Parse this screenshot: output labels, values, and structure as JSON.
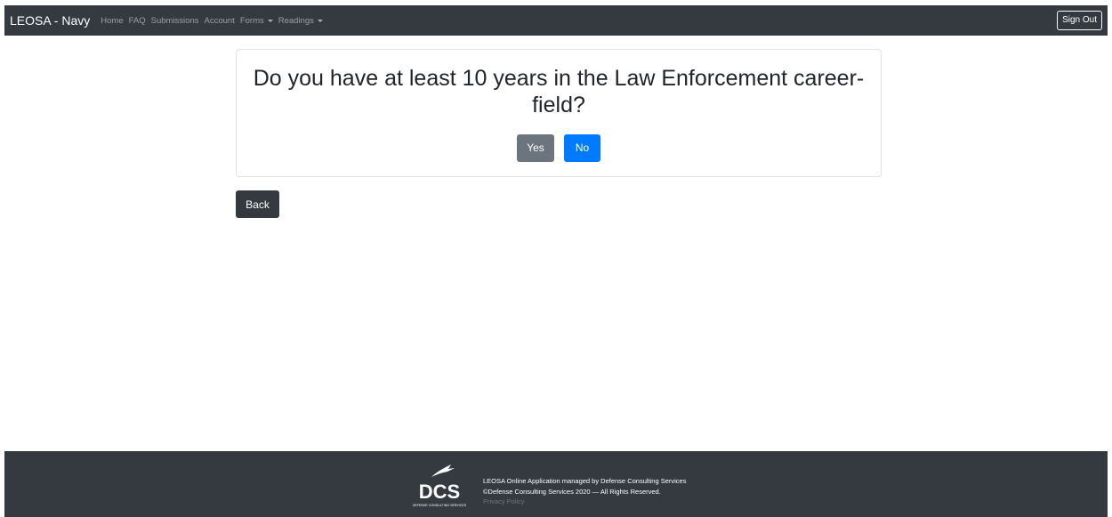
{
  "navbar": {
    "brand": "LEOSA - Navy",
    "links": [
      "Home",
      "FAQ",
      "Submissions",
      "Account"
    ],
    "dropdowns": [
      "Forms",
      "Readings"
    ],
    "sign_out": "Sign Out"
  },
  "question": {
    "text": "Do you have at least 10 years in the Law Enforcement career-field?",
    "yes_label": "Yes",
    "no_label": "No"
  },
  "back_label": "Back",
  "footer": {
    "logo_text": "DCS",
    "logo_subtext": "DEFENSE CONSULTING SERVICES",
    "line1": "LEOSA Online Application managed by Defense Consulting Services",
    "line2": "©Defense Consulting Services 2020 — All Rights Reserved.",
    "privacy": "Privacy Policy"
  },
  "colors": {
    "navbar_bg": "#343a40",
    "primary": "#007bff",
    "secondary": "#6c757d"
  }
}
